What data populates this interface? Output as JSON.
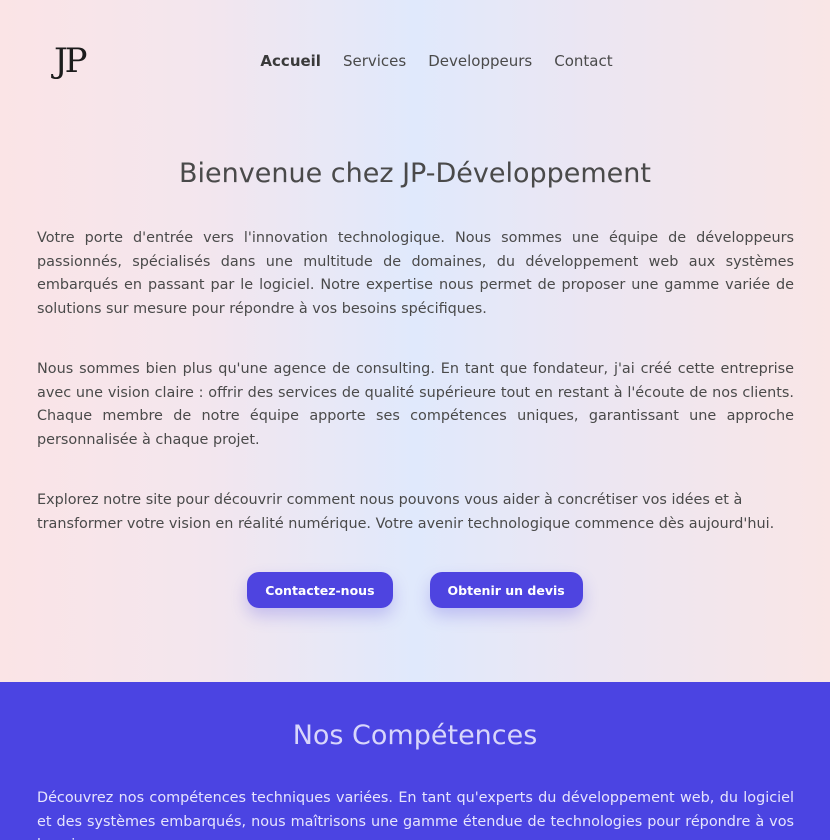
{
  "header": {
    "logo": "JP",
    "nav": [
      {
        "label": "Accueil",
        "active": true
      },
      {
        "label": "Services",
        "active": false
      },
      {
        "label": "Developpeurs",
        "active": false
      },
      {
        "label": "Contact",
        "active": false
      }
    ]
  },
  "hero": {
    "title": "Bienvenue chez JP-Développement",
    "paragraphs": [
      "Votre porte d'entrée vers l'innovation technologique. Nous sommes une équipe de développeurs passionnés, spécialisés dans une multitude de domaines, du développement web aux systèmes embarqués en passant par le logiciel. Notre expertise nous permet de proposer une gamme variée de solutions sur mesure pour répondre à vos besoins spécifiques.",
      "Nous sommes bien plus qu'une agence de consulting. En tant que fondateur, j'ai créé cette entreprise avec une vision claire : offrir des services de qualité supérieure tout en restant à l'écoute de nos clients. Chaque membre de notre équipe apporte ses compétences uniques, garantissant une approche personnalisée à chaque projet.",
      "Explorez notre site pour découvrir comment nous pouvons vous aider à concrétiser vos idées et à transformer votre vision en réalité numérique. Votre avenir technologique commence dès aujourd'hui."
    ],
    "buttons": {
      "contact": "Contactez-nous",
      "quote": "Obtenir un devis"
    }
  },
  "skills": {
    "title": "Nos Compétences",
    "intro": "Découvrez nos compétences techniques variées. En tant qu'experts du développement web, du logiciel et des systèmes embarqués, nous maîtrisons une gamme étendue de technologies pour répondre à vos besoins"
  },
  "colors": {
    "accent": "#4b44e2",
    "button": "#4e44e0",
    "text": "#4a4a4a"
  }
}
